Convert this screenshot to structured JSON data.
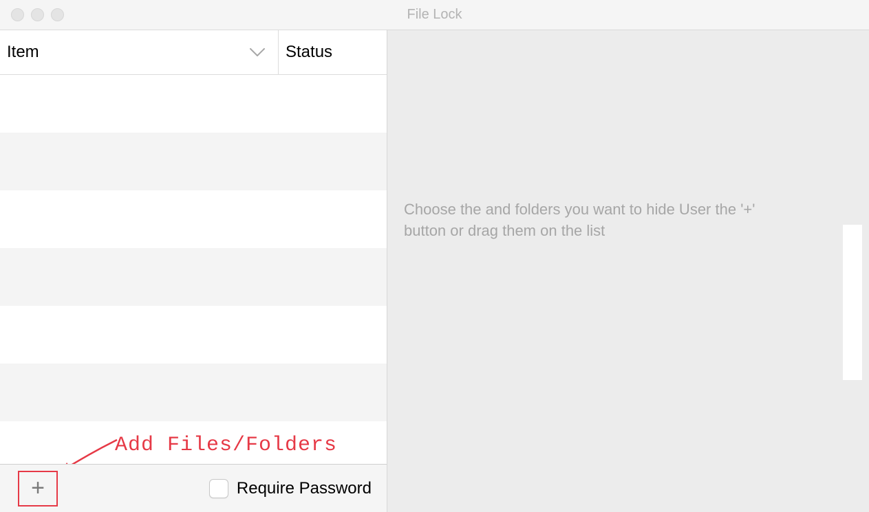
{
  "window": {
    "title": "File Lock"
  },
  "table": {
    "columns": {
      "item": "Item",
      "status": "Status"
    }
  },
  "toolbar": {
    "add_symbol": "+",
    "require_password_label": "Require Password"
  },
  "right_pane": {
    "help_text": "Choose the and folders you want to hide User the '+' button or drag them on the list"
  },
  "annotation": {
    "label": "Add Files/Folders"
  }
}
